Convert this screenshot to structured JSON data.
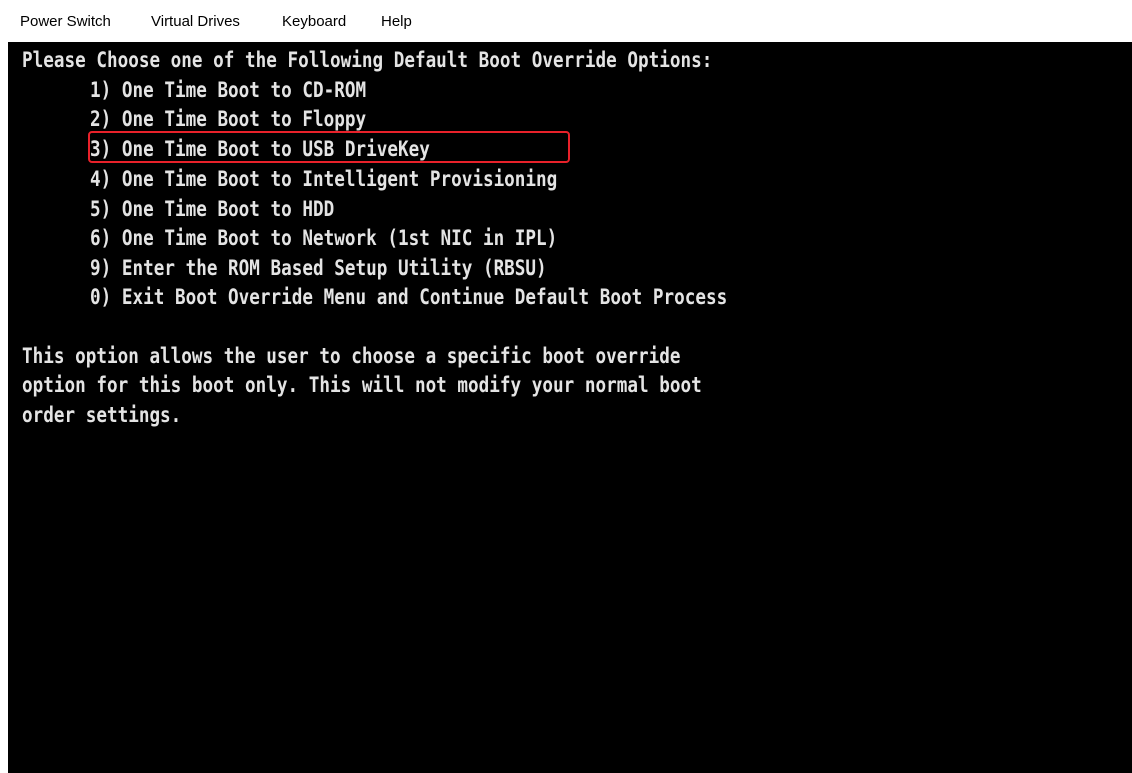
{
  "menubar": {
    "items": [
      "Power Switch",
      "Virtual Drives",
      "Keyboard",
      "Help"
    ]
  },
  "console": {
    "heading": "Please Choose one of the Following Default Boot Override Options:",
    "options": [
      "1) One Time Boot to CD-ROM",
      "2) One Time Boot to Floppy",
      "3) One Time Boot to USB DriveKey",
      "4) One Time Boot to Intelligent Provisioning",
      "5) One Time Boot to HDD",
      "6) One Time Boot to Network (1st NIC in IPL)",
      "9) Enter the ROM Based Setup Utility (RBSU)",
      "0) Exit Boot Override Menu and Continue Default Boot Process"
    ],
    "description": [
      "This option allows the user to choose a specific boot override",
      "option for this boot only. This will not modify your normal boot",
      "order settings."
    ],
    "highlighted_option": "3) One Time Boot to USB DriveKey"
  },
  "colors": {
    "console_background": "#000000",
    "console_text": "#e4e4e4",
    "highlight_border": "#e8212a",
    "menubar_background": "#ffffff"
  }
}
